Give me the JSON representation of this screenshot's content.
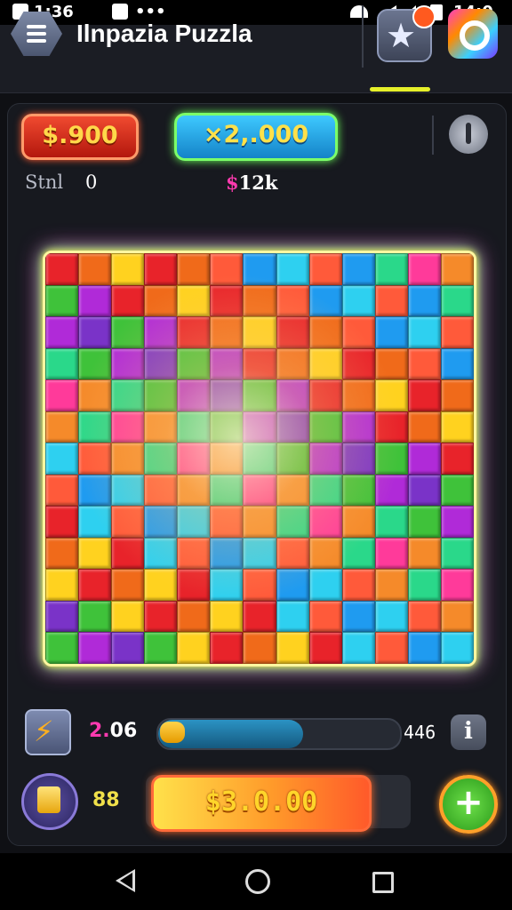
{
  "status_bar": {
    "time": "1:36",
    "clock": "14:0"
  },
  "header": {
    "title": "Ilnpazia Puzzla"
  },
  "hud": {
    "cash": "$.900",
    "multiplier": "×2,.000",
    "stat_label": "Stnl",
    "stat_value": "0",
    "bonus": "$12k"
  },
  "board": {
    "rows": 13,
    "cols": 13,
    "palette": [
      "#e8232a",
      "#3fc23a",
      "#f58a2a",
      "#2ed0f0",
      "#ffd21f",
      "#7a33c8",
      "#ff3a9a",
      "#1f9bf0",
      "#f06a1a",
      "#b02ad8",
      "#2ad88a",
      "#ff5a3a"
    ]
  },
  "progress": {
    "level": "2.06",
    "target": "446",
    "fill_fraction": 0.6,
    "info_label": "i"
  },
  "bottom": {
    "coins": "88",
    "buy_label": "$3.0.00",
    "add_label": "+"
  },
  "icons": {
    "menu": "menu-icon",
    "favorite": "star-icon",
    "settings": "ring-icon",
    "power": "power-icon",
    "boost": "lightning-icon",
    "info": "info-icon",
    "coins": "coin-jar-icon",
    "add": "plus-icon"
  }
}
